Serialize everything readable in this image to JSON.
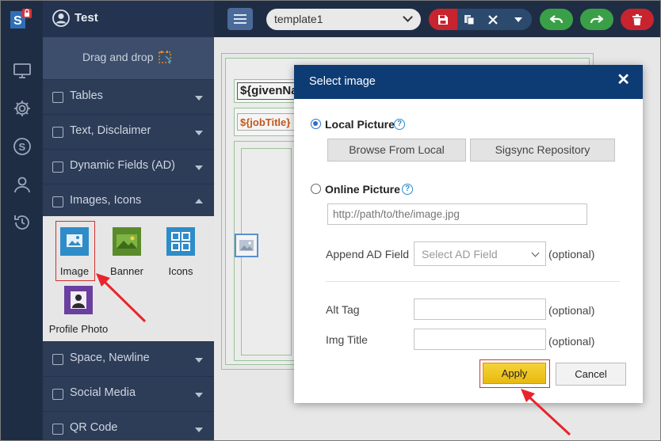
{
  "header": {
    "user_name": "Test",
    "template_name": "template1"
  },
  "panel": {
    "dragdrop_label": "Drag and drop",
    "sections": [
      {
        "label": "Tables"
      },
      {
        "label": "Text, Disclaimer"
      },
      {
        "label": "Dynamic Fields (AD)"
      },
      {
        "label": "Images, Icons"
      },
      {
        "label": "Space, Newline"
      },
      {
        "label": "Social Media"
      },
      {
        "label": "QR Code"
      }
    ],
    "image_tools": [
      {
        "label": "Image"
      },
      {
        "label": "Banner"
      },
      {
        "label": "Icons"
      },
      {
        "label": "Profile Photo"
      }
    ]
  },
  "canvas": {
    "given_field": "${givenName}",
    "job_field": "${jobTitle}"
  },
  "modal": {
    "title": "Select image",
    "close_glyph": "✕",
    "local_picture_label": "Local Picture",
    "browse_local_label": "Browse From Local",
    "sigsync_repo_label": "Sigsync Repository",
    "online_picture_label": "Online Picture",
    "url_placeholder": "http://path/to/the/image.jpg",
    "append_ad_label": "Append AD Field",
    "select_ad_placeholder": "Select AD Field",
    "optional_text": "(optional)",
    "alt_tag_label": "Alt Tag",
    "img_title_label": "Img Title",
    "apply_label": "Apply",
    "cancel_label": "Cancel",
    "help_glyph": "?"
  },
  "colors": {
    "topbar": "#1f2d44",
    "modal_header": "#0d3c74",
    "apply_yellow": "#f2c81e",
    "highlight_red": "#d43030"
  }
}
